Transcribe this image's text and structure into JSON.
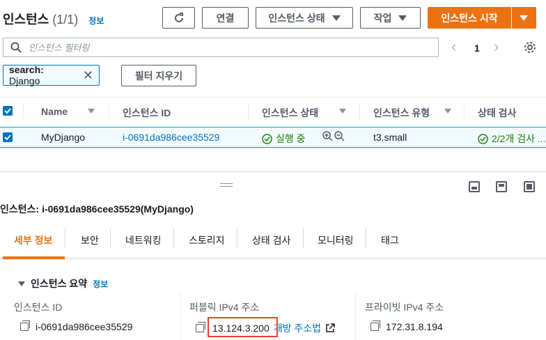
{
  "header": {
    "title": "인스턴스",
    "count": "(1/1)",
    "info": "정보",
    "connect": "연결",
    "instance_state": "인스턴스 상태",
    "actions": "작업",
    "launch": "인스턴스 시작"
  },
  "search": {
    "placeholder": "인스턴스 필터링",
    "page": "1"
  },
  "filter": {
    "token_key": "search:",
    "token_value": "Django",
    "clear": "필터 지우기"
  },
  "table": {
    "headers": [
      "Name",
      "인스턴스 ID",
      "인스턴스 상태",
      "인스턴스 유형",
      "상태 검사"
    ],
    "row": {
      "name": "MyDjango",
      "id": "i-0691da986cee35529",
      "state": "실행 중",
      "type": "t3.small",
      "check": "2/2개 검사 ..."
    }
  },
  "details": {
    "title": "인스턴스: i-0691da986cee35529(MyDjango)",
    "tabs": [
      "세부 정보",
      "보안",
      "네트워킹",
      "스토리지",
      "상태 검사",
      "모니터링",
      "태그"
    ],
    "summary_title": "인스턴스 요약",
    "summary_info": "정보",
    "fields": [
      {
        "label": "인스턴스 ID",
        "value": "i-0691da986cee35529"
      },
      {
        "label": "퍼블릭 IPv4 주소",
        "value": "13.124.3.200",
        "link": "개방 주소법"
      },
      {
        "label": "프라이빗 IPv4 주소",
        "value": "172.31.8.194"
      }
    ]
  },
  "colors": {
    "primary": "#ec7211",
    "link": "#0073bb",
    "success": "#1d8102",
    "highlight": "#e8412a"
  }
}
